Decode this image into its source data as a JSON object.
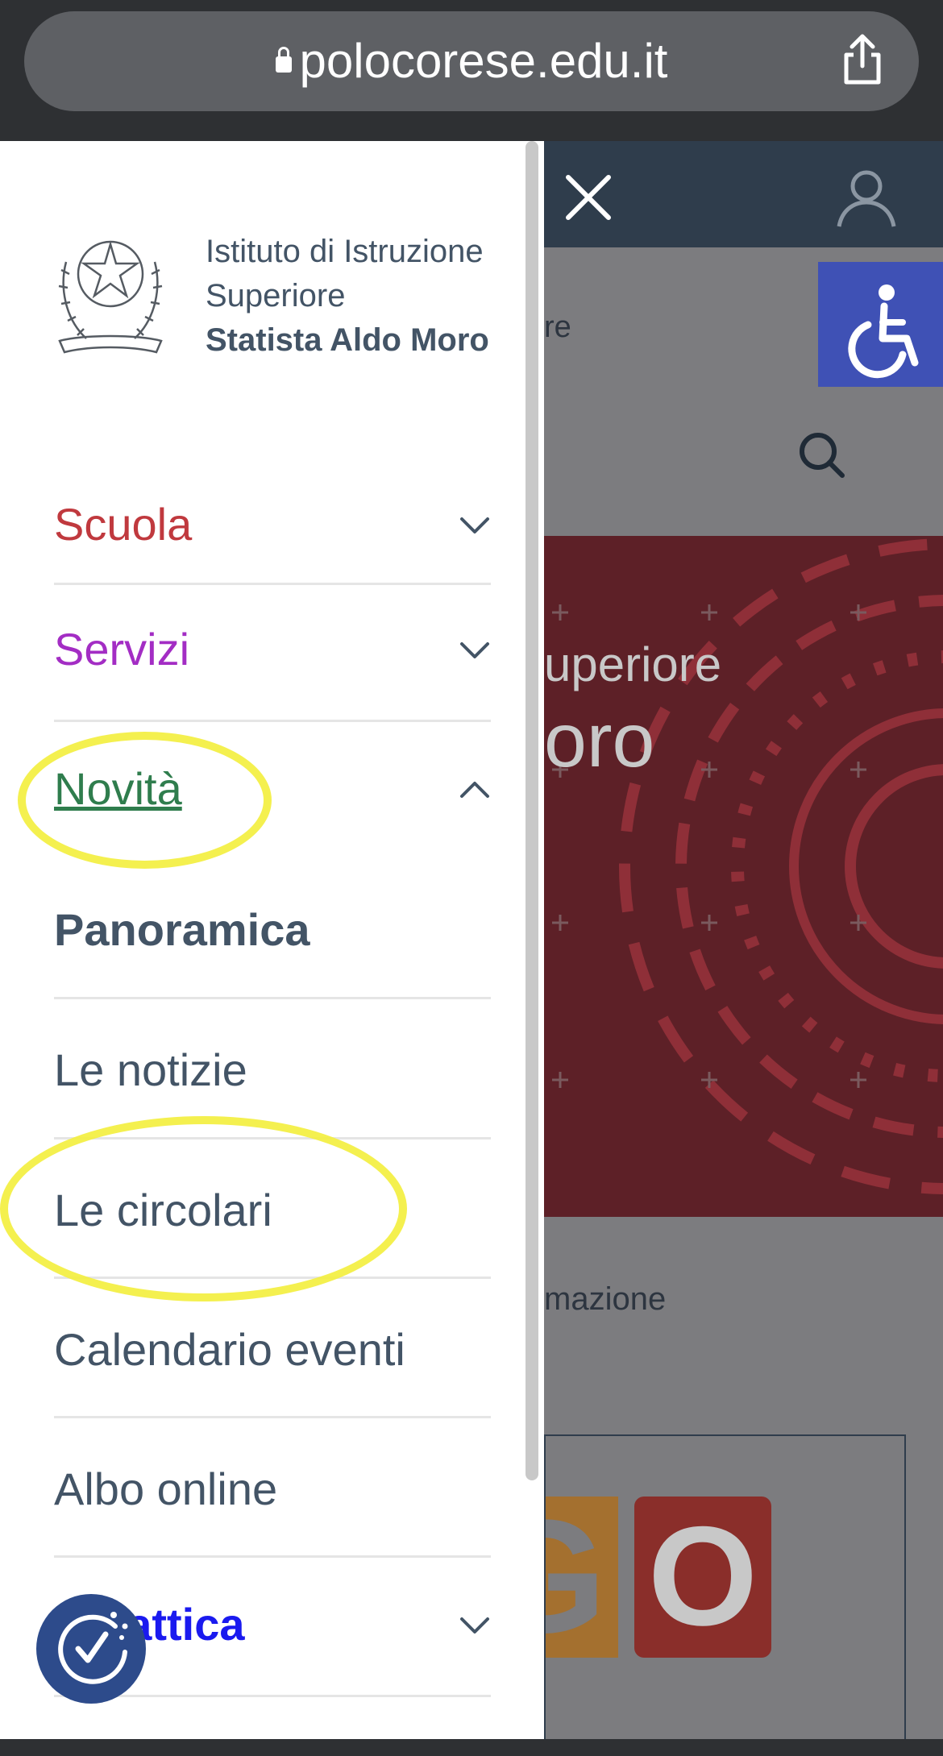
{
  "browser": {
    "url": "polocorese.edu.it",
    "lock_icon": "lock-icon",
    "share_icon": "share-icon"
  },
  "header": {
    "school_line1": "Istituto di Istruzione",
    "school_line2": "Superiore",
    "school_name": "Statista Aldo Moro",
    "emblem_icon": "italian-republic-emblem-icon"
  },
  "menu": {
    "items": [
      {
        "label": "Scuola",
        "color": "#c0393e",
        "expanded": false
      },
      {
        "label": "Servizi",
        "color": "#a32dc4",
        "expanded": false
      },
      {
        "label": "Novità",
        "color": "#2f7d4d",
        "expanded": true
      },
      {
        "label": "Didattica",
        "color": "#1a1aef",
        "expanded": false
      }
    ],
    "subitems": [
      {
        "label": "Panoramica"
      },
      {
        "label": "Le notizie"
      },
      {
        "label": "Le circolari"
      },
      {
        "label": "Calendario eventi"
      },
      {
        "label": "Albo online"
      }
    ]
  },
  "background": {
    "partial_text_1": "re",
    "hero_line1": "uperiore",
    "hero_line2": "oro",
    "partial_text_2": "mazione",
    "banner_letter1": "G",
    "banner_letter2": "O"
  },
  "colors": {
    "accent_blue": "#3f51b5",
    "header_dark": "#2f3d4c",
    "highlight": "#f3ee3c"
  }
}
